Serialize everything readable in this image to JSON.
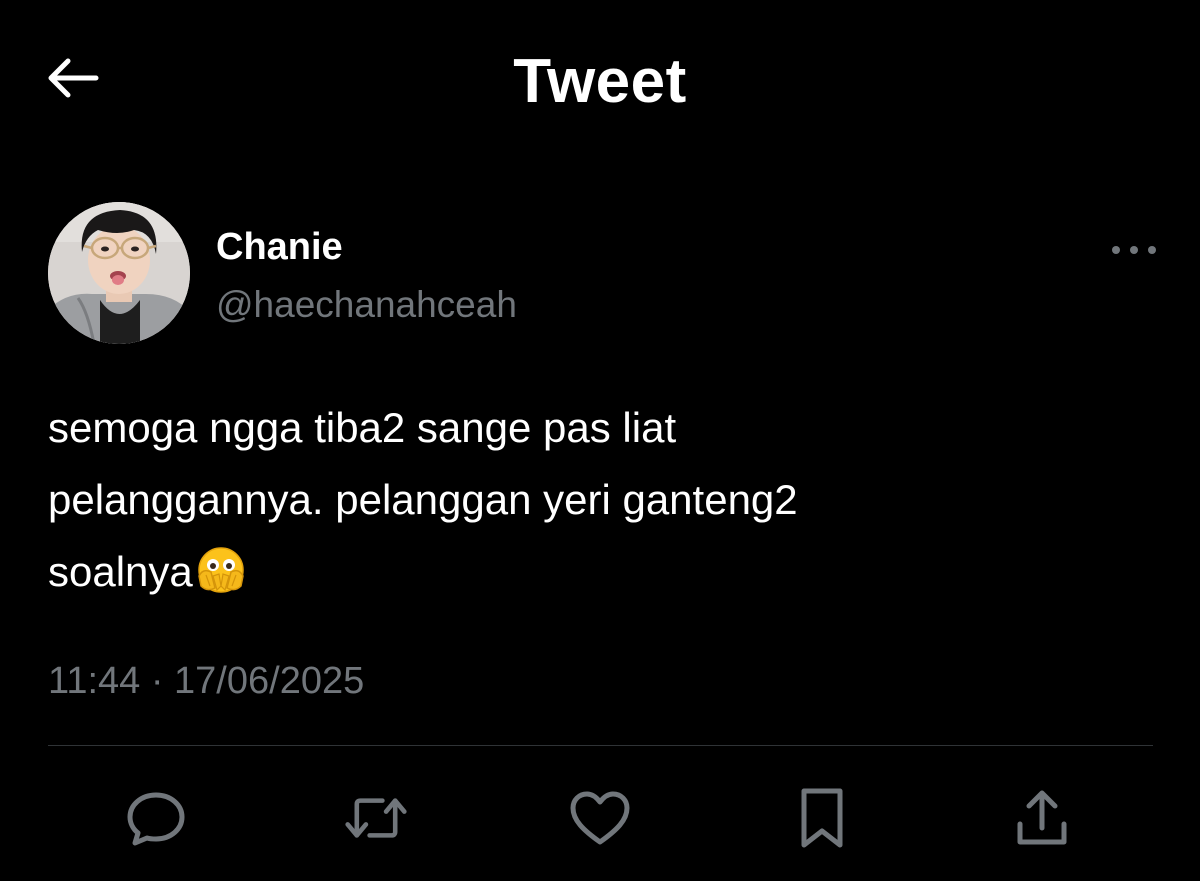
{
  "header": {
    "title": "Tweet",
    "back_icon": "arrow-left-icon"
  },
  "tweet": {
    "author": {
      "display_name": "Chanie",
      "handle": "@haechanahceah",
      "avatar": "profile-photo"
    },
    "more_icon": "ellipsis-icon",
    "text_lines": [
      "semoga ngga tiba2 sange pas liat",
      "pelanggannya. pelanggan yeri ganteng2",
      "soalnya"
    ],
    "emoji": "face-with-open-eyes-and-hand-over-mouth-emoji",
    "timestamp": "11:44 · 17/06/2025"
  },
  "actions": [
    {
      "name": "reply",
      "icon": "comment-icon"
    },
    {
      "name": "retweet",
      "icon": "retweet-icon"
    },
    {
      "name": "like",
      "icon": "heart-icon"
    },
    {
      "name": "bookmark",
      "icon": "bookmark-icon"
    },
    {
      "name": "share",
      "icon": "share-icon"
    }
  ],
  "colors": {
    "background": "#000000",
    "text_primary": "#ffffff",
    "text_secondary": "#71767b",
    "divider": "#2f3336"
  }
}
